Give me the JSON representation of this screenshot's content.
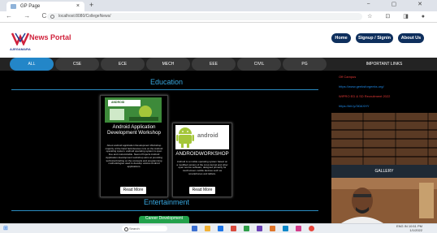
{
  "browser": {
    "tab_title": "GP Page",
    "tab_close": "×",
    "new_tab": "+",
    "window_controls": "−  ▢  ✕",
    "url": "localhost:8080/CollegeNews/",
    "nav_buttons": "←  →  C  ⌂",
    "extras": "☆ ⊡ ◨ ●"
  },
  "header": {
    "logo_text": "News Portal",
    "logo_sub": "AJEGAMARA",
    "buttons": [
      "Home",
      "Signup / Signin",
      "About Us"
    ]
  },
  "menu": {
    "items": [
      "ALL",
      "CSE",
      "ECE",
      "MECH",
      "EEE",
      "CIVIL",
      "PG"
    ],
    "active_index": 0,
    "accent": "#2386c8"
  },
  "main": {
    "section_education": "Education",
    "section_entertainment": "Entertainment",
    "cards": [
      {
        "title": "Android Application Development Workshop",
        "image_label": "ANDROID",
        "desc": "About android application Development Workshop majority of the hand held devices runs on the Android operating system. android operating system is open free and customizable. Neenu Projects Android Application development workshop aims at providing technical briefing on the concepts and programming methodologies used to develop various Android applications.",
        "read_more": "Read More"
      },
      {
        "title": "ANDROIDWORKSHOP",
        "image_label": "android",
        "desc": "Android is a mobile operating system based on a modified version of the Linux kernel and other open source software, designed primarily for touchscreen mobile devices such as smartphones and tablets.",
        "read_more": "Read More"
      }
    ],
    "career_label": "Career Development"
  },
  "sidebar": {
    "important_links_title": "IMPORTANT LINKS",
    "links": [
      {
        "text": "Off Campus",
        "color": "#e53935"
      },
      {
        "text": "https://www.geeksforgeeks.org/",
        "color": "#1e88e5"
      },
      {
        "text": "WIPRO ED & SD Recruitment 2022",
        "color": "#e53935"
      },
      {
        "text": "https://bit.ly/3l0AXHY",
        "color": "#1e88e5"
      }
    ],
    "gallery_title": "GALLERY"
  },
  "taskbar": {
    "search_placeholder": "Search",
    "time": "10:51 PM",
    "date": "1/1/2022",
    "lang": "ENG IN"
  }
}
